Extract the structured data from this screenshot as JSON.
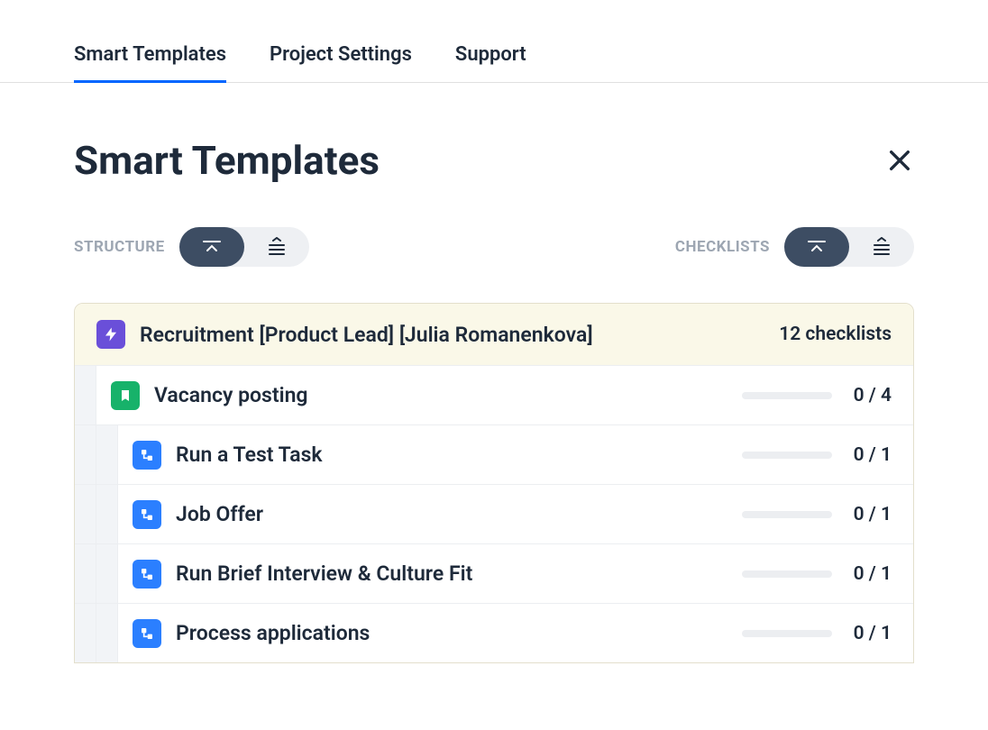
{
  "tabs": [
    {
      "label": "Smart Templates",
      "active": true
    },
    {
      "label": "Project Settings",
      "active": false
    },
    {
      "label": "Support",
      "active": false
    }
  ],
  "page_title": "Smart Templates",
  "controls": {
    "structure_label": "STRUCTURE",
    "checklists_label": "CHECKLISTS"
  },
  "group": {
    "title": "Recruitment [Product Lead] [Julia Romanenkova]",
    "count_label": "12 checklists"
  },
  "rows": [
    {
      "title": "Vacancy posting",
      "counter": "0 / 4",
      "icon": "green",
      "indent": 1
    },
    {
      "title": "Run a Test Task",
      "counter": "0 / 1",
      "icon": "blue",
      "indent": 2
    },
    {
      "title": "Job Offer",
      "counter": "0 / 1",
      "icon": "blue",
      "indent": 2
    },
    {
      "title": "Run Brief Interview & Culture Fit",
      "counter": "0 / 1",
      "icon": "blue",
      "indent": 2
    },
    {
      "title": "Process applications",
      "counter": "0 / 1",
      "icon": "blue",
      "indent": 2
    }
  ]
}
